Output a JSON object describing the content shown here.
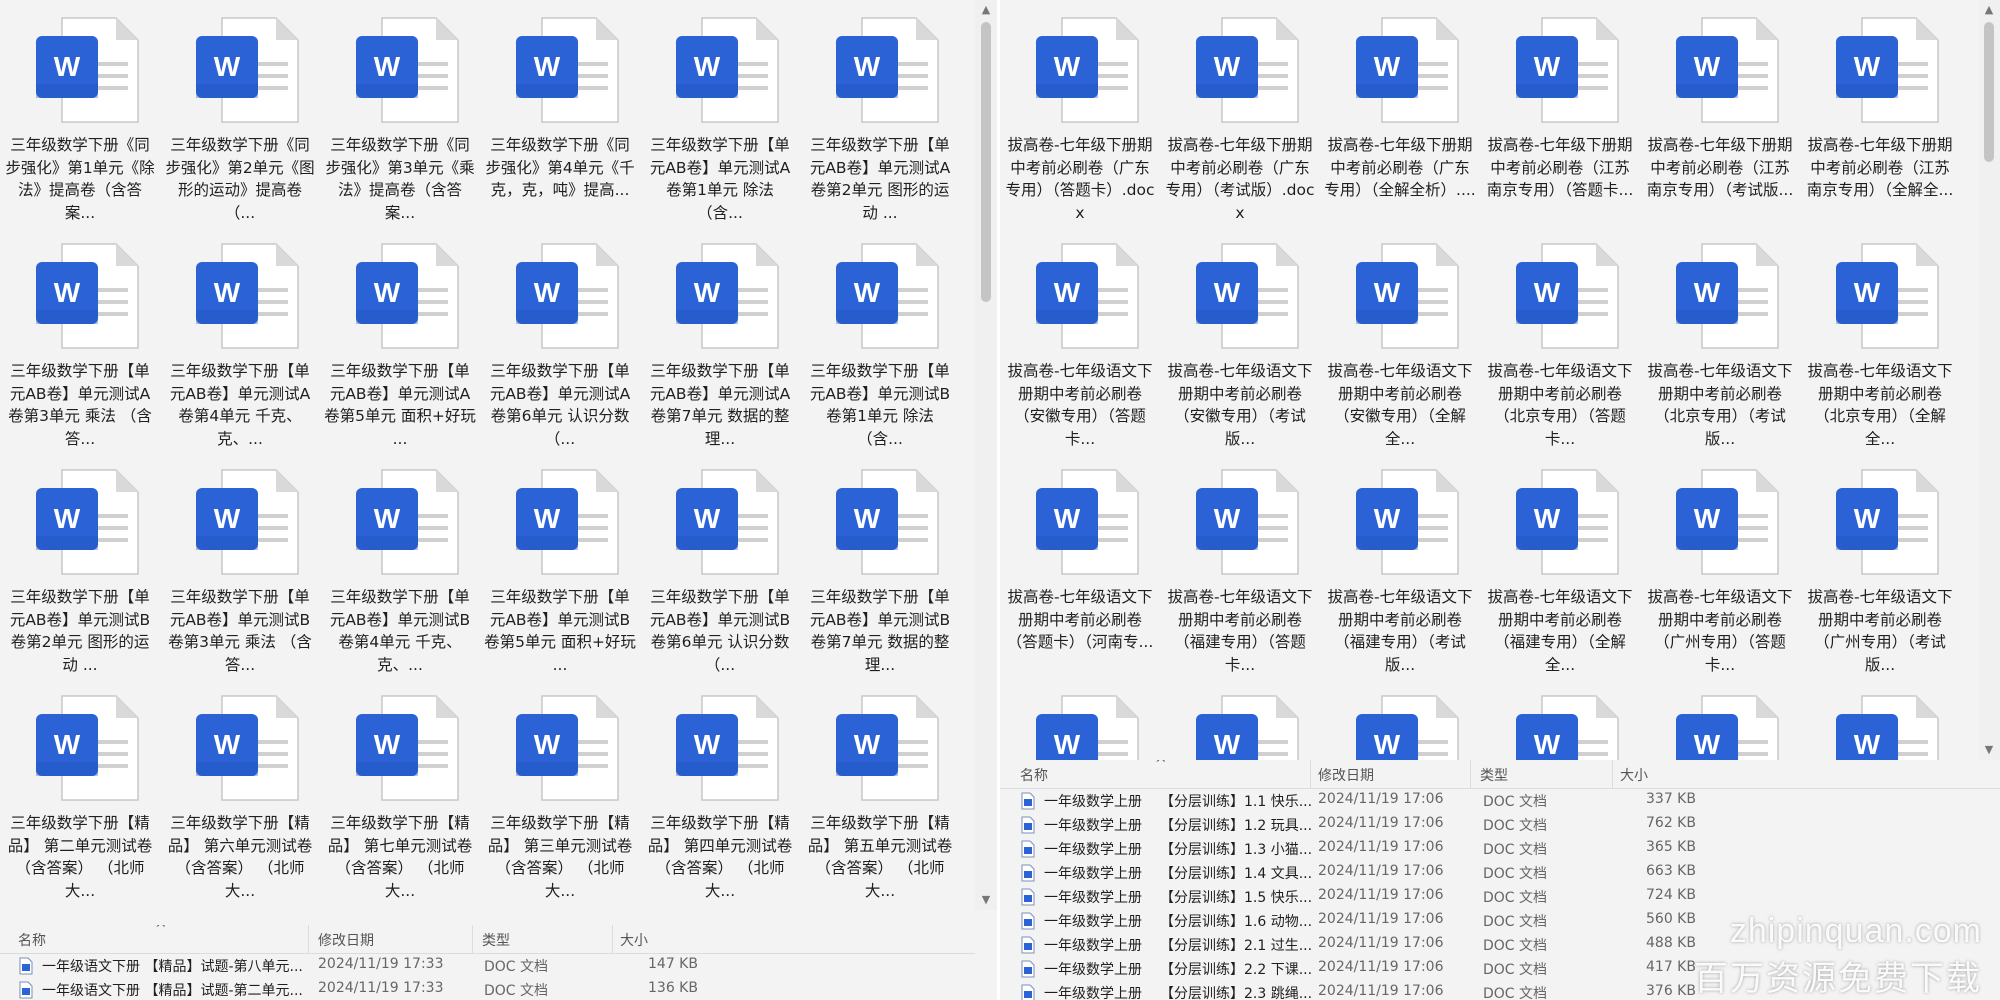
{
  "colors": {
    "word_blue": "#2b63d6",
    "word_blue_dark": "#1d4fb8",
    "page_bg": "#ffffff",
    "page_fold": "#d9d9d9"
  },
  "icon_letter": "W",
  "left": {
    "files": [
      "三年级数学下册《同步强化》第1单元《除法》提高卷（含答案...",
      "三年级数学下册《同步强化》第2单元《图形的运动》提高卷（...",
      "三年级数学下册《同步强化》第3单元《乘法》提高卷（含答案...",
      "三年级数学下册《同步强化》第4单元《千克，克，吨》提高...",
      "三年级数学下册【单元AB卷】单元测试A卷第1单元 除法 （含...",
      "三年级数学下册【单元AB卷】单元测试A卷第2单元 图形的运动 ...",
      "三年级数学下册【单元AB卷】单元测试A卷第3单元 乘法 （含答...",
      "三年级数学下册【单元AB卷】单元测试A卷第4单元 千克、克、...",
      "三年级数学下册【单元AB卷】单元测试A卷第5单元 面积+好玩 ...",
      "三年级数学下册【单元AB卷】单元测试A卷第6单元 认识分数 （...",
      "三年级数学下册【单元AB卷】单元测试A卷第7单元 数据的整理...",
      "三年级数学下册【单元AB卷】单元测试B卷第1单元 除法 （含...",
      "三年级数学下册【单元AB卷】单元测试B卷第2单元 图形的运动 ...",
      "三年级数学下册【单元AB卷】单元测试B卷第3单元 乘法 （含答...",
      "三年级数学下册【单元AB卷】单元测试B卷第4单元 千克、克、...",
      "三年级数学下册【单元AB卷】单元测试B卷第5单元 面积+好玩 ...",
      "三年级数学下册【单元AB卷】单元测试B卷第6单元 认识分数 （...",
      "三年级数学下册【单元AB卷】单元测试B卷第7单元 数据的整理...",
      "三年级数学下册【精品】 第二单元测试卷 （含答案） （北师大...",
      "三年级数学下册【精品】 第六单元测试卷 （含答案） （北师大...",
      "三年级数学下册【精品】 第七单元测试卷 （含答案） （北师大...",
      "三年级数学下册【精品】 第三单元测试卷 （含答案） （北师大...",
      "三年级数学下册【精品】 第四单元测试卷 （含答案） （北师大...",
      "三年级数学下册【精品】 第五单元测试卷 （含答案） （北师大..."
    ],
    "list": {
      "headers": {
        "name": "名称",
        "date": "修改日期",
        "type": "类型",
        "size": "大小"
      },
      "rows": [
        {
          "name": "一年级语文下册 【精品】试题-第八单元...",
          "date": "2024/11/19 17:33",
          "type": "DOC 文档",
          "size": "147 KB"
        },
        {
          "name": "一年级语文下册 【精品】试题-第二单元...",
          "date": "2024/11/19 17:33",
          "type": "DOC 文档",
          "size": "136 KB"
        }
      ]
    }
  },
  "right": {
    "files": [
      "拔高卷-七年级下册期中考前必刷卷（广东专用）（答题卡）.docx",
      "拔高卷-七年级下册期中考前必刷卷（广东专用）（考试版）.docx",
      "拔高卷-七年级下册期中考前必刷卷（广东专用）（全解全析）....",
      "拔高卷-七年级下册期中考前必刷卷（江苏南京专用）（答题卡...",
      "拔高卷-七年级下册期中考前必刷卷（江苏南京专用）（考试版...",
      "拔高卷-七年级下册期中考前必刷卷（江苏南京专用）（全解全...",
      "拔高卷-七年级语文下册期中考前必刷卷（安徽专用）（答题卡...",
      "拔高卷-七年级语文下册期中考前必刷卷（安徽专用）（考试版...",
      "拔高卷-七年级语文下册期中考前必刷卷（安徽专用）（全解全...",
      "拔高卷-七年级语文下册期中考前必刷卷（北京专用）（答题卡...",
      "拔高卷-七年级语文下册期中考前必刷卷（北京专用）（考试版...",
      "拔高卷-七年级语文下册期中考前必刷卷（北京专用）（全解全...",
      "拔高卷-七年级语文下册期中考前必刷卷（答题卡）（河南专...",
      "拔高卷-七年级语文下册期中考前必刷卷（福建专用）（答题卡...",
      "拔高卷-七年级语文下册期中考前必刷卷（福建专用）（考试版...",
      "拔高卷-七年级语文下册期中考前必刷卷（福建专用）（全解全...",
      "拔高卷-七年级语文下册期中考前必刷卷（广州专用）（答题卡...",
      "拔高卷-七年级语文下册期中考前必刷卷（广州专用）（考试版...",
      "",
      "",
      "",
      "",
      "",
      ""
    ],
    "list": {
      "headers": {
        "name": "名称",
        "date": "修改日期",
        "type": "类型",
        "size": "大小"
      },
      "rows": [
        {
          "grade": "一年级数学上册",
          "name": "【分层训练】1.1 快乐...",
          "date": "2024/11/19 17:06",
          "type": "DOC 文档",
          "size": "337 KB"
        },
        {
          "grade": "一年级数学上册",
          "name": "【分层训练】1.2 玩具...",
          "date": "2024/11/19 17:06",
          "type": "DOC 文档",
          "size": "762 KB"
        },
        {
          "grade": "一年级数学上册",
          "name": "【分层训练】1.3 小猫...",
          "date": "2024/11/19 17:06",
          "type": "DOC 文档",
          "size": "365 KB"
        },
        {
          "grade": "一年级数学上册",
          "name": "【分层训练】1.4 文具...",
          "date": "2024/11/19 17:06",
          "type": "DOC 文档",
          "size": "663 KB"
        },
        {
          "grade": "一年级数学上册",
          "name": "【分层训练】1.5 快乐...",
          "date": "2024/11/19 17:06",
          "type": "DOC 文档",
          "size": "724 KB"
        },
        {
          "grade": "一年级数学上册",
          "name": "【分层训练】1.6 动物...",
          "date": "2024/11/19 17:06",
          "type": "DOC 文档",
          "size": "560 KB"
        },
        {
          "grade": "一年级数学上册",
          "name": "【分层训练】2.1 过生...",
          "date": "2024/11/19 17:06",
          "type": "DOC 文档",
          "size": "488 KB"
        },
        {
          "grade": "一年级数学上册",
          "name": "【分层训练】2.2 下课...",
          "date": "2024/11/19 17:06",
          "type": "DOC 文档",
          "size": "417 KB"
        },
        {
          "grade": "一年级数学上册",
          "name": "【分层训练】2.3 跳绳...",
          "date": "2024/11/19 17:06",
          "type": "DOC 文档",
          "size": "376 KB"
        }
      ]
    }
  },
  "watermark": {
    "domain": "zhipinquan.com",
    "slogan": "百万资源免费下载"
  }
}
